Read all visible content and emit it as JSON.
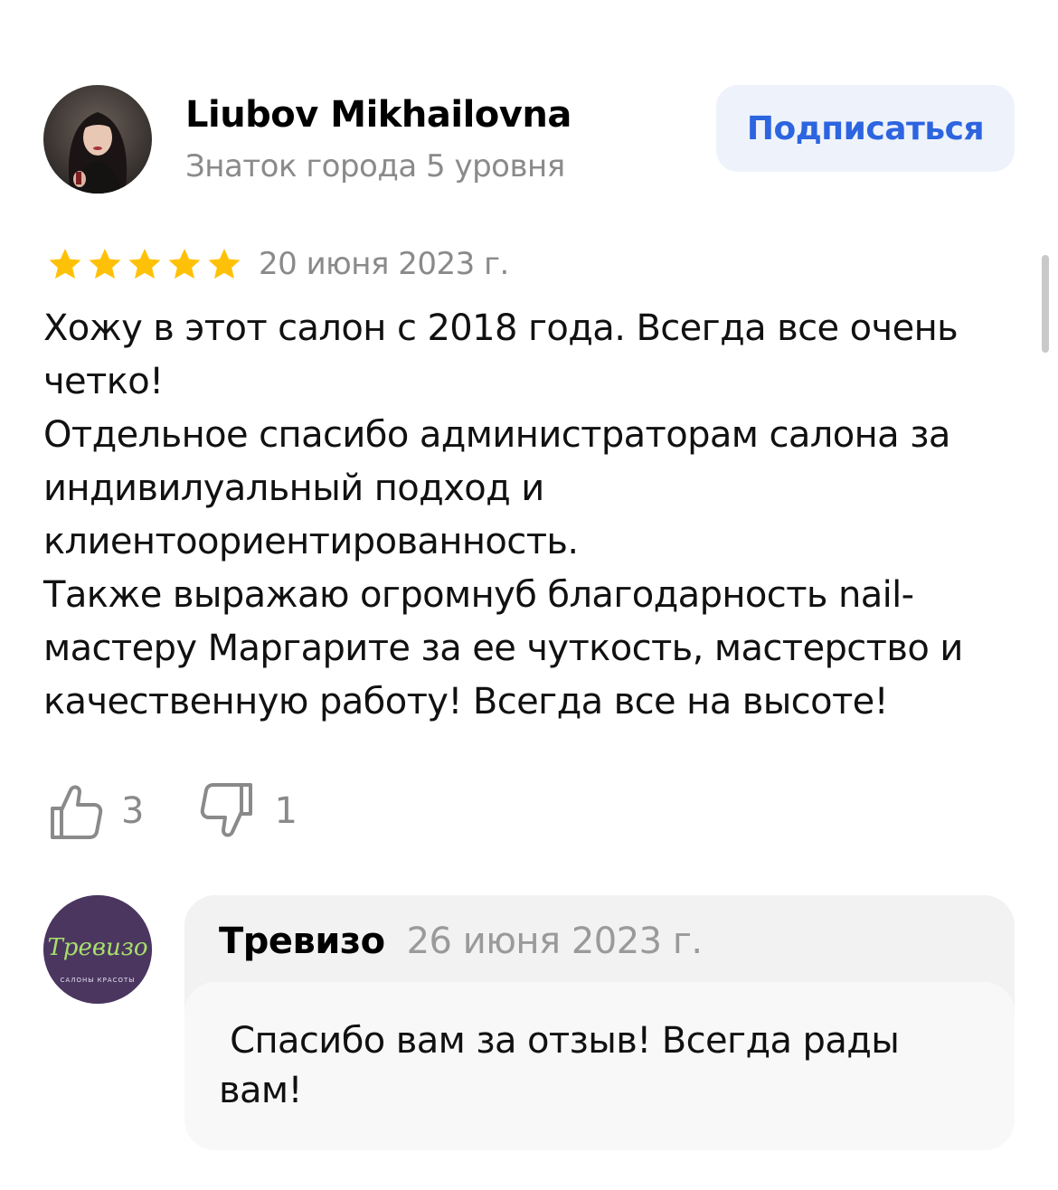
{
  "author": {
    "name": "Liubov Mikhailovna",
    "level": "Знаток города 5 уровня",
    "avatar_icon": "user-photo-avatar"
  },
  "subscribe_label": "Подписаться",
  "review": {
    "rating": 5,
    "rating_max": 5,
    "date": "20 июня 2023 г.",
    "paragraphs": [
      "Хожу в этот салон с 2018 года. Всегда все очень четко!",
      "Отдельное спасибо администраторам салона за индивилуальный подход и клиентоориентированность.",
      "Также выражаю огромнуб благодарность nail-мастеру Маргарите за ее чуткость, мастерство и качественную работу! Всегда все на высоте!"
    ],
    "likes": "3",
    "dislikes": "1"
  },
  "reply": {
    "name": "Тревизо",
    "date": "26 июня 2023 г.",
    "text": " Спасибо вам за отзыв! Всегда рады вам!",
    "logo_text": "Тревизо",
    "logo_subtext": "САЛОНЫ КРАСОТЫ"
  },
  "colors": {
    "accent": "#2d64e0",
    "star": "#ffc107",
    "muted": "#8a8a8a",
    "logo_bg": "#4b3660",
    "logo_text": "#a8e06a"
  }
}
